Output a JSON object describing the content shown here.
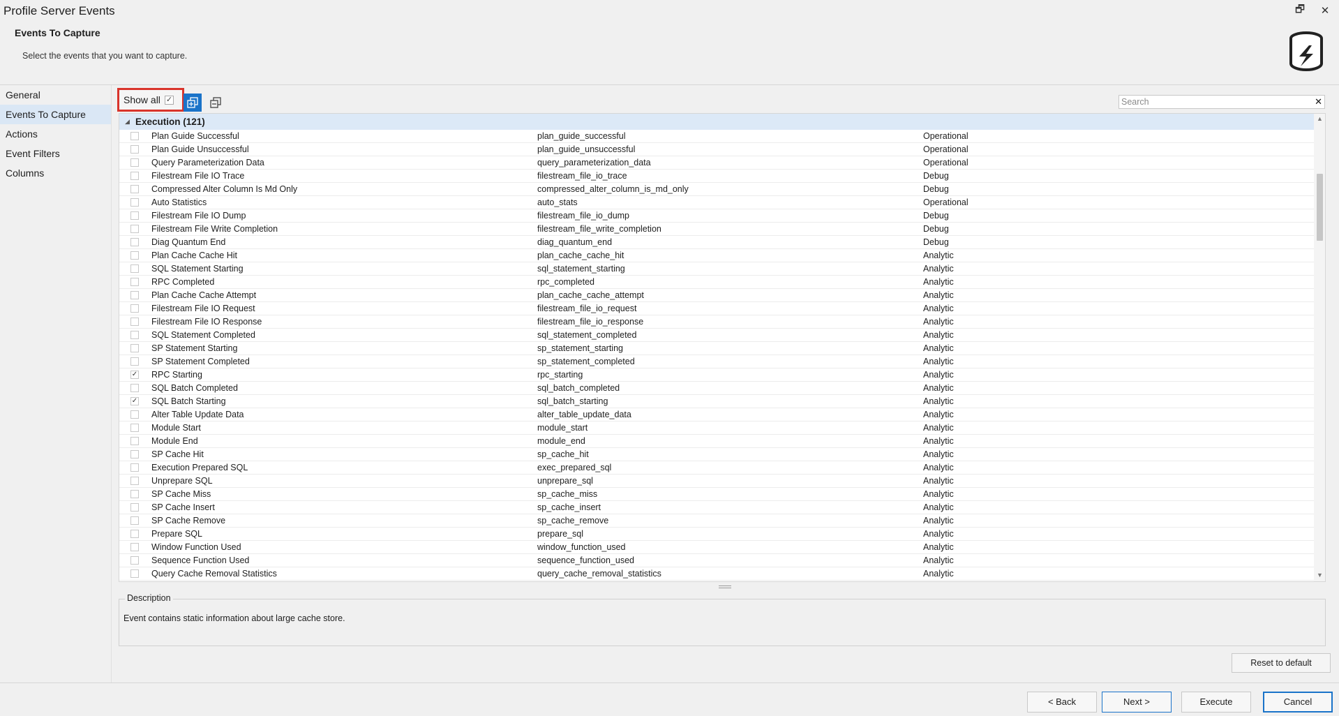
{
  "window": {
    "title": "Profile Server Events",
    "restore_glyph": "🗗",
    "close_glyph": "✕"
  },
  "header": {
    "title": "Events To Capture",
    "subtitle": "Select the events that you want to capture.",
    "logo_icon": "database-profiler-icon"
  },
  "nav": {
    "items": [
      {
        "label": "General"
      },
      {
        "label": "Events To Capture",
        "active": true
      },
      {
        "label": "Actions"
      },
      {
        "label": "Event Filters"
      },
      {
        "label": "Columns"
      }
    ]
  },
  "toolbar": {
    "show_all_label": "Show all",
    "show_all_checked": true,
    "check_glyph": "✓"
  },
  "search": {
    "placeholder": "Search",
    "value": "",
    "clear_glyph": "✕"
  },
  "grid": {
    "group_label": "Execution (121)",
    "toggle_glyph": "◢",
    "rows": [
      {
        "name": "Plan Guide Successful",
        "id": "plan_guide_successful",
        "channel": "Operational",
        "checked": false
      },
      {
        "name": "Plan Guide Unsuccessful",
        "id": "plan_guide_unsuccessful",
        "channel": "Operational",
        "checked": false
      },
      {
        "name": "Query Parameterization Data",
        "id": "query_parameterization_data",
        "channel": "Operational",
        "checked": false
      },
      {
        "name": "Filestream File IO Trace",
        "id": "filestream_file_io_trace",
        "channel": "Debug",
        "checked": false
      },
      {
        "name": "Compressed Alter Column Is Md Only",
        "id": "compressed_alter_column_is_md_only",
        "channel": "Debug",
        "checked": false
      },
      {
        "name": "Auto Statistics",
        "id": "auto_stats",
        "channel": "Operational",
        "checked": false
      },
      {
        "name": "Filestream File IO Dump",
        "id": "filestream_file_io_dump",
        "channel": "Debug",
        "checked": false
      },
      {
        "name": "Filestream File Write Completion",
        "id": "filestream_file_write_completion",
        "channel": "Debug",
        "checked": false
      },
      {
        "name": "Diag Quantum End",
        "id": "diag_quantum_end",
        "channel": "Debug",
        "checked": false
      },
      {
        "name": "Plan Cache Cache Hit",
        "id": "plan_cache_cache_hit",
        "channel": "Analytic",
        "checked": false
      },
      {
        "name": "SQL Statement Starting",
        "id": "sql_statement_starting",
        "channel": "Analytic",
        "checked": false
      },
      {
        "name": "RPC Completed",
        "id": "rpc_completed",
        "channel": "Analytic",
        "checked": false
      },
      {
        "name": "Plan Cache Cache Attempt",
        "id": "plan_cache_cache_attempt",
        "channel": "Analytic",
        "checked": false
      },
      {
        "name": "Filestream File IO Request",
        "id": "filestream_file_io_request",
        "channel": "Analytic",
        "checked": false
      },
      {
        "name": "Filestream File IO Response",
        "id": "filestream_file_io_response",
        "channel": "Analytic",
        "checked": false
      },
      {
        "name": "SQL Statement Completed",
        "id": "sql_statement_completed",
        "channel": "Analytic",
        "checked": false
      },
      {
        "name": "SP Statement Starting",
        "id": "sp_statement_starting",
        "channel": "Analytic",
        "checked": false
      },
      {
        "name": "SP Statement Completed",
        "id": "sp_statement_completed",
        "channel": "Analytic",
        "checked": false
      },
      {
        "name": "RPC Starting",
        "id": "rpc_starting",
        "channel": "Analytic",
        "checked": true
      },
      {
        "name": "SQL Batch Completed",
        "id": "sql_batch_completed",
        "channel": "Analytic",
        "checked": false
      },
      {
        "name": "SQL Batch Starting",
        "id": "sql_batch_starting",
        "channel": "Analytic",
        "checked": true
      },
      {
        "name": "Alter Table Update Data",
        "id": "alter_table_update_data",
        "channel": "Analytic",
        "checked": false
      },
      {
        "name": "Module Start",
        "id": "module_start",
        "channel": "Analytic",
        "checked": false
      },
      {
        "name": "Module End",
        "id": "module_end",
        "channel": "Analytic",
        "checked": false
      },
      {
        "name": "SP Cache Hit",
        "id": "sp_cache_hit",
        "channel": "Analytic",
        "checked": false
      },
      {
        "name": "Execution Prepared SQL",
        "id": "exec_prepared_sql",
        "channel": "Analytic",
        "checked": false
      },
      {
        "name": "Unprepare SQL",
        "id": "unprepare_sql",
        "channel": "Analytic",
        "checked": false
      },
      {
        "name": "SP Cache Miss",
        "id": "sp_cache_miss",
        "channel": "Analytic",
        "checked": false
      },
      {
        "name": "SP Cache Insert",
        "id": "sp_cache_insert",
        "channel": "Analytic",
        "checked": false
      },
      {
        "name": "SP Cache Remove",
        "id": "sp_cache_remove",
        "channel": "Analytic",
        "checked": false
      },
      {
        "name": "Prepare SQL",
        "id": "prepare_sql",
        "channel": "Analytic",
        "checked": false
      },
      {
        "name": "Window Function Used",
        "id": "window_function_used",
        "channel": "Analytic",
        "checked": false
      },
      {
        "name": "Sequence Function Used",
        "id": "sequence_function_used",
        "channel": "Analytic",
        "checked": false
      },
      {
        "name": "Query Cache Removal Statistics",
        "id": "query_cache_removal_statistics",
        "channel": "Analytic",
        "checked": false
      }
    ]
  },
  "scrollbar": {
    "up_glyph": "▲",
    "down_glyph": "▼"
  },
  "description": {
    "legend": "Description",
    "text": "Event contains static information about large cache store."
  },
  "buttons": {
    "reset": "Reset to default",
    "back": "< Back",
    "next": "Next >",
    "execute": "Execute",
    "cancel": "Cancel"
  },
  "colors": {
    "accent": "#1a73c9",
    "highlight_border": "#d9342b",
    "group_row_bg": "#dce9f7",
    "nav_active_bg": "#dae7f5"
  }
}
